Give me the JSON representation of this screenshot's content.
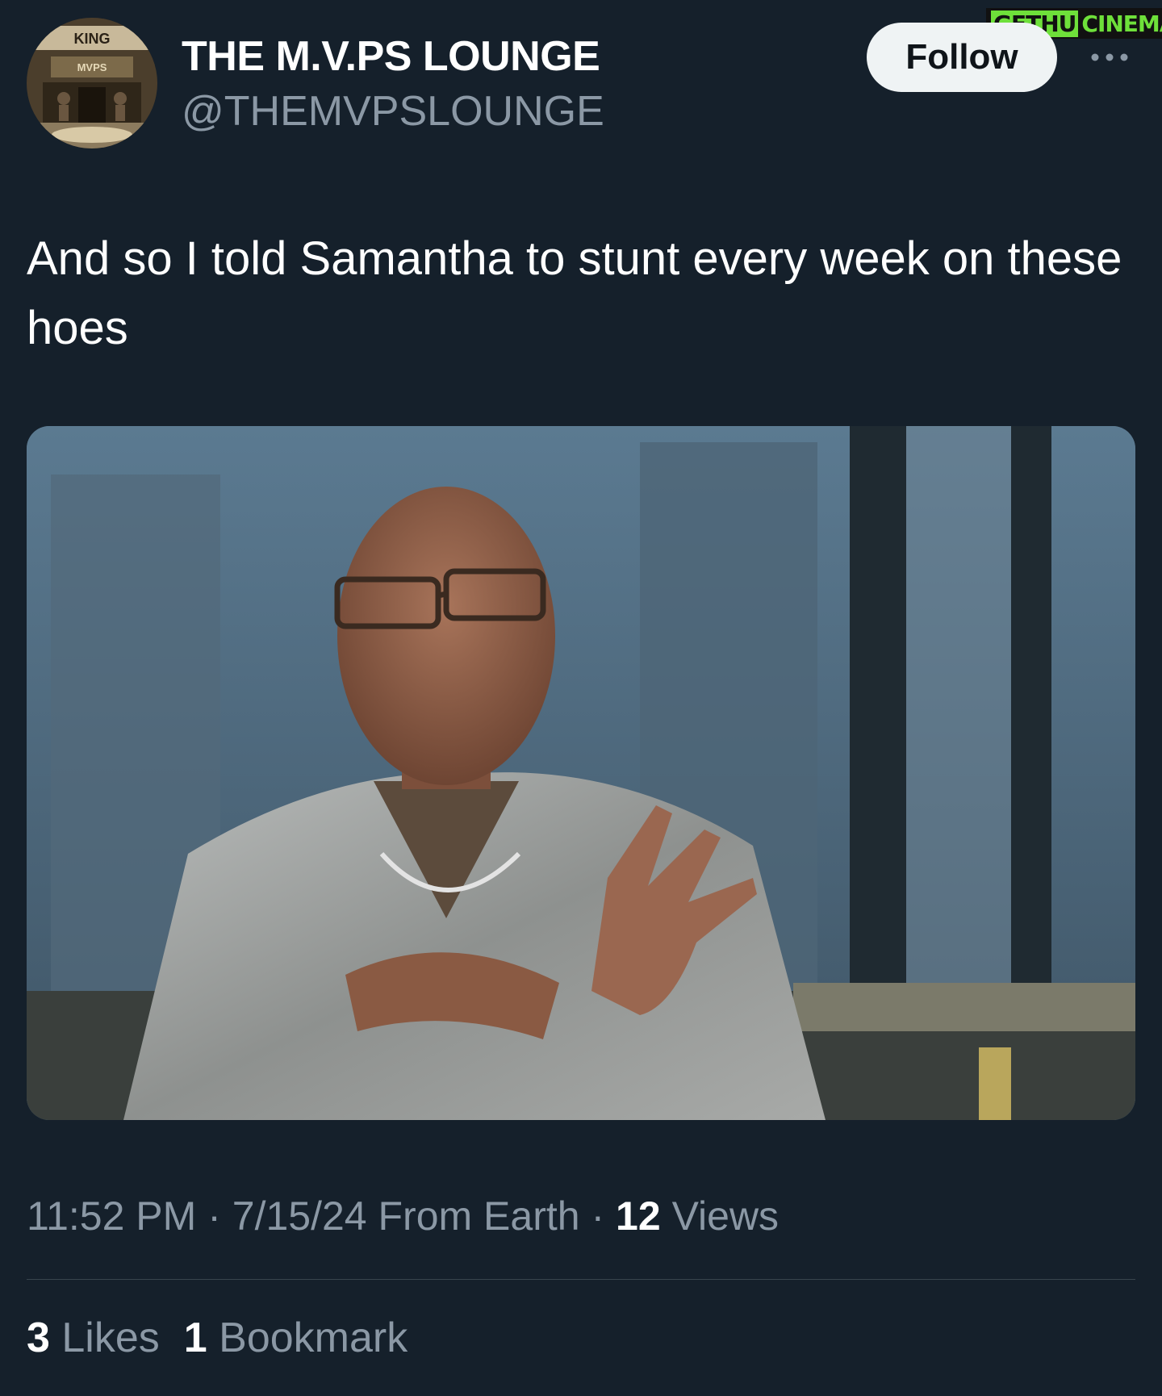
{
  "author": {
    "display_name": "THE M.V.PS LOUNGE",
    "handle": "@THEMVPSLOUNGE",
    "avatar_icon": "lounge-avatar-image",
    "avatar_text": [
      "KING",
      "MVPS"
    ]
  },
  "header": {
    "follow_label": "Follow",
    "more_icon": "more-options-icon"
  },
  "watermark": {
    "part1": "GETHU",
    "part2": "CINEMA",
    "color": "#6ee03a"
  },
  "tweet": {
    "text": "And so I told Samantha to stunt every week on these hoes",
    "media_icon": "attached-photo"
  },
  "meta": {
    "time": "11:52 PM",
    "separator": "·",
    "date": "7/15/24",
    "source": "From Earth",
    "views_count": "12",
    "views_label": "Views"
  },
  "stats": {
    "likes_count": "3",
    "likes_label": "Likes",
    "bookmarks_count": "1",
    "bookmarks_label": "Bookmark"
  },
  "colors": {
    "background": "#15202b",
    "secondary_text": "#8b98a5",
    "follow_bg": "#eff3f4",
    "divider": "#38444d"
  }
}
